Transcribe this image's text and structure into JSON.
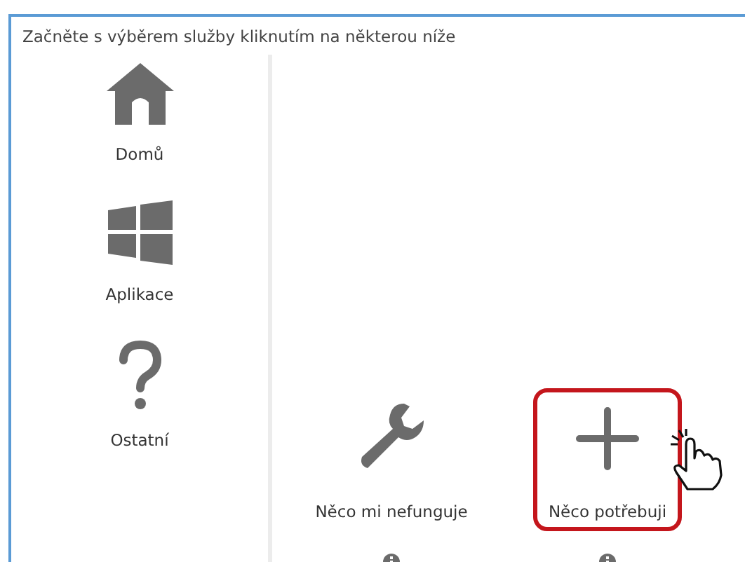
{
  "header": {
    "text": "Začněte s výběrem služby kliknutím na některou níže"
  },
  "sidebar": {
    "items": [
      {
        "label": "Domů"
      },
      {
        "label": "Aplikace"
      },
      {
        "label": "Ostatní"
      }
    ]
  },
  "services": [
    {
      "label": "Něco mi nefunguje",
      "highlighted": false
    },
    {
      "label": "Něco potřebuji",
      "highlighted": true
    }
  ]
}
